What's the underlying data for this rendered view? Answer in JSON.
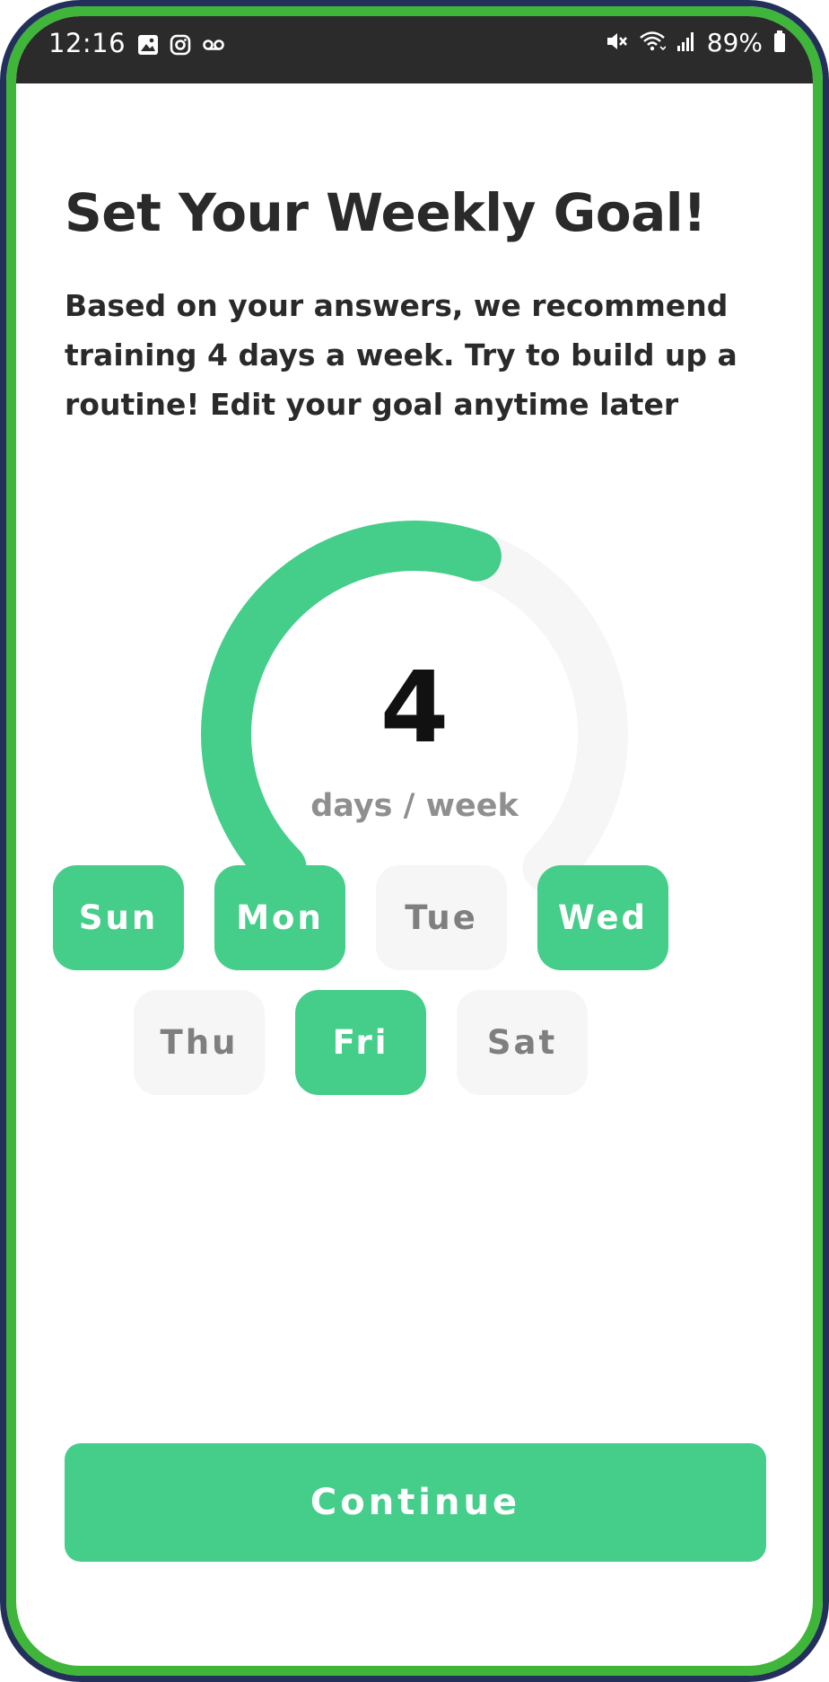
{
  "status_bar": {
    "time": "12:16",
    "battery_percent": "89%",
    "left_icons": [
      "gallery-icon",
      "instagram-icon",
      "voicemail-icon"
    ],
    "right_icons": [
      "mute-icon",
      "wifi-icon",
      "signal-icon",
      "battery-icon"
    ]
  },
  "page": {
    "title": "Set Your Weekly Goal!",
    "subtitle": "Based on your answers, we recommend training 4 days a week. Try to build up a routine! Edit your goal anytime later"
  },
  "goal": {
    "days_per_week": "4",
    "unit_label": "days / week",
    "max_days": 7,
    "progress_fraction": 0.571,
    "emoji": "flexed-biceps-icon"
  },
  "days": [
    {
      "label": "Sun",
      "selected": true
    },
    {
      "label": "Mon",
      "selected": true
    },
    {
      "label": "Tue",
      "selected": false
    },
    {
      "label": "Wed",
      "selected": true
    },
    {
      "label": "Thu",
      "selected": false
    },
    {
      "label": "Fri",
      "selected": true
    },
    {
      "label": "Sat",
      "selected": false
    }
  ],
  "actions": {
    "continue_label": "Continue"
  },
  "colors": {
    "accent": "#45cd8a",
    "track": "#f6f6f6",
    "frame_outer": "#23305a",
    "frame_inner": "#3fb63a",
    "status_bar": "#2b2b2b"
  }
}
